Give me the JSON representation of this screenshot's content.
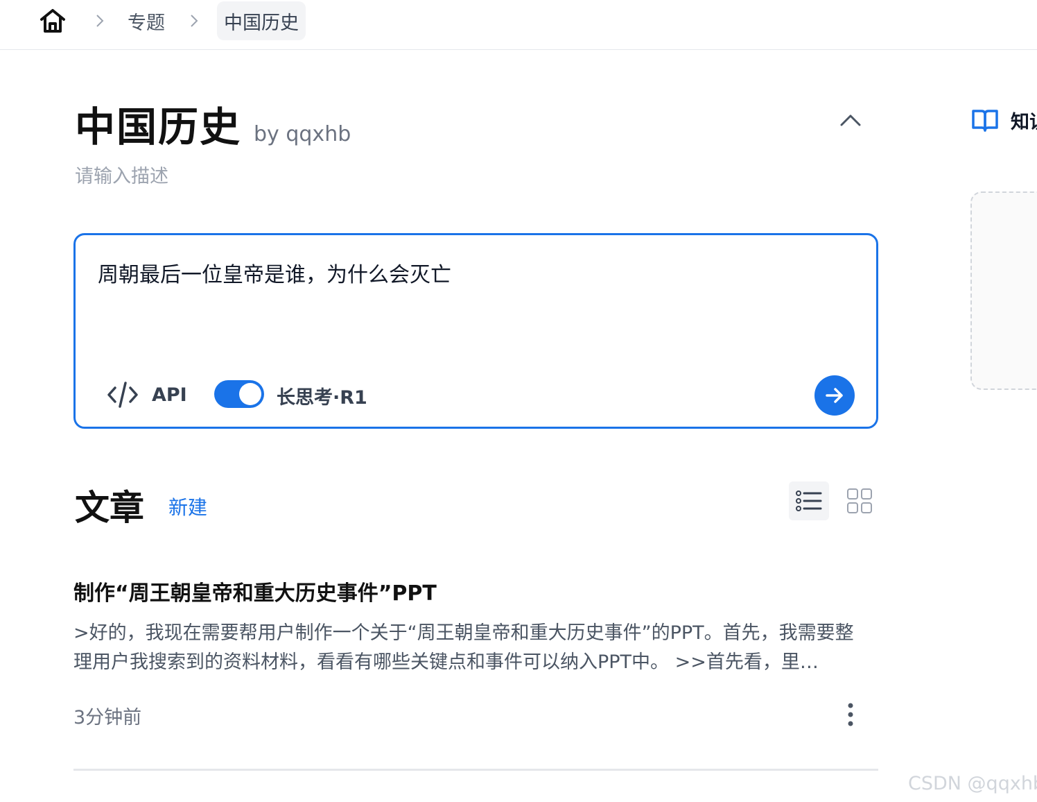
{
  "breadcrumb": {
    "items": [
      {
        "label": "专题"
      },
      {
        "label": "中国历史"
      }
    ]
  },
  "header": {
    "title": "中国历史",
    "author": "by qqxhb",
    "description_placeholder": "请输入描述"
  },
  "side_panel": {
    "label": "知识库"
  },
  "prompt_box": {
    "text": "周朝最后一位皇帝是谁，为什么会灭亡",
    "api_label": "API",
    "deep_think": {
      "enabled": true,
      "label": "长思考·R1"
    }
  },
  "articles": {
    "section_title": "文章",
    "new_label": "新建",
    "view_mode": "list",
    "items": [
      {
        "title": "制作“周王朝皇帝和重大历史事件”PPT",
        "excerpt": ">好的，我现在需要帮用户制作一个关于“周王朝皇帝和重大历史事件”的PPT。首先，我需要整理用户我搜索到的资料材料，看看有哪些关键点和事件可以纳入PPT中。 >>首先看，里…",
        "time": "3分钟前"
      }
    ]
  },
  "watermark": "CSDN @qqxhb",
  "colors": {
    "accent": "#1a73e8",
    "text_primary": "#111111",
    "text_secondary": "#4b5563",
    "placeholder": "#9ca3af",
    "border": "#e5e7eb"
  },
  "icons": [
    "home-icon",
    "chevron-right-icon",
    "chevron-up-icon",
    "book-icon",
    "code-icon",
    "arrow-right-icon",
    "list-view-icon",
    "grid-view-icon",
    "more-vertical-icon"
  ]
}
